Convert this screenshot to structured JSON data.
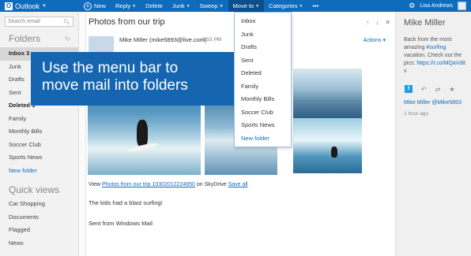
{
  "topbar": {
    "app_name": "Outlook",
    "commands": {
      "new": "New",
      "reply": "Reply",
      "delete": "Delete",
      "junk": "Junk",
      "sweep": "Sweep",
      "move_to": "Move to",
      "categories": "Categories",
      "more": "•••"
    },
    "user_name": "Lisa Andrews",
    "brand_color": "#0f6cbd"
  },
  "leftnav": {
    "search_placeholder": "Search email",
    "folders_heading": "Folders",
    "folders": [
      {
        "label": "Inbox",
        "count": "3"
      },
      {
        "label": "Junk"
      },
      {
        "label": "Drafts"
      },
      {
        "label": "Sent"
      },
      {
        "label": "Deleted",
        "count": "1"
      },
      {
        "label": "Family"
      },
      {
        "label": "Monthly Bills"
      },
      {
        "label": "Soccer Club"
      },
      {
        "label": "Sports News"
      },
      {
        "label": "New folder"
      }
    ],
    "quickviews_heading": "Quick views",
    "quickviews": [
      "Car Shopping",
      "Documents",
      "Flagged",
      "News"
    ]
  },
  "message": {
    "subject": "Photos from our trip",
    "sender": "Mike Miller (mike5893@live.com)",
    "time": "3:53 PM",
    "actions_label": "Actions",
    "view_prefix": "View",
    "album_link": "Photos from our trip 10302012224850",
    "view_mid": "on SkyDrive",
    "save_all": "Save all",
    "body_line1": "The kids had a blast surfing!",
    "body_line2": "Sent from Windows Mail"
  },
  "callout": {
    "line1": "Use the menu bar to",
    "line2": "move mail into folders"
  },
  "move_menu": {
    "items": [
      "Inbox",
      "Junk",
      "Drafts",
      "Sent",
      "Deleted",
      "Family",
      "Monthly Bills",
      "Soccer Club",
      "Sports News"
    ],
    "new_folder": "New folder"
  },
  "social": {
    "name": "Mike Miller",
    "tweet_part1": "Back from the most amazing ",
    "tweet_hashtag": "#surfing",
    "tweet_part2": " vacation. Check out the pics: ",
    "tweet_link": "https://t.co/MQaVdit",
    "tweet_end": "v",
    "handle": "Mike Miller @Mike5893",
    "time": "1 hour ago"
  }
}
